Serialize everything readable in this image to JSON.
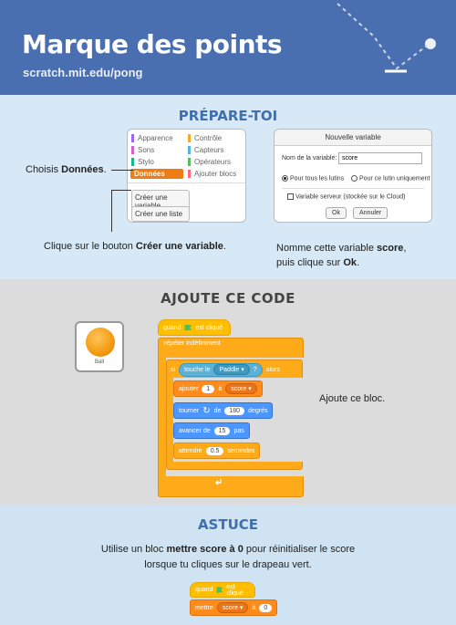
{
  "header": {
    "title": "Marque des points",
    "url": "scratch.mit.edu/pong"
  },
  "prepare": {
    "title": "PRÉPARE-TOI",
    "categories": [
      {
        "label": "Apparence",
        "color": "#9966ff"
      },
      {
        "label": "Contrôle",
        "color": "#ffab19"
      },
      {
        "label": "Sons",
        "color": "#cf63cf"
      },
      {
        "label": "Capteurs",
        "color": "#5cb1d6"
      },
      {
        "label": "Stylo",
        "color": "#0fbd8c"
      },
      {
        "label": "Opérateurs",
        "color": "#59c059"
      },
      {
        "label": "Données",
        "color": "#ff8c1a"
      },
      {
        "label": "Ajouter blocs",
        "color": "#ff6680"
      }
    ],
    "make_var_button": "Créer une variable",
    "make_list_button": "Créer une liste",
    "choose_text_prefix": "Choisis ",
    "choose_text_bold": "Données",
    "choose_text_suffix": ".",
    "click_text_prefix": "Clique sur le bouton ",
    "click_text_bold": "Créer une variable",
    "click_text_suffix": ".",
    "name_text_1": "Nomme cette variable ",
    "name_text_bold1": "score",
    "name_text_2": ",",
    "name_text_3": "puis clique sur ",
    "name_text_bold2": "Ok",
    "name_text_4": ".",
    "dialog": {
      "title": "Nouvelle variable",
      "name_label": "Nom de la variable:",
      "name_value": "score",
      "radio_all": "Pour tous les lutins",
      "radio_this": "Pour ce lutin uniquement",
      "cloud_label": "Variable serveur (stockée sur le Cloud)",
      "ok": "Ok",
      "cancel": "Annuler"
    }
  },
  "code": {
    "title": "AJOUTE CE CODE",
    "sprite_name": "Ball",
    "when_flag": "quand",
    "clicked": "est cliqué",
    "forever": "répéter indéfiniment",
    "if": "si",
    "touching": "touche le",
    "paddle": "Paddle",
    "q": "?",
    "then": "alors",
    "add": "ajouter",
    "add_value": "1",
    "to": "à",
    "score_var": "score",
    "turn": "tourner",
    "of": "de",
    "turn_value": "180",
    "degrees": "degrés",
    "move": "avancer de",
    "move_value": "15",
    "steps": "pas",
    "wait": "attendre",
    "wait_value": "0.5",
    "seconds": "secondes",
    "note": "Ajoute ce bloc."
  },
  "tip": {
    "title": "ASTUCE",
    "line1_a": "Utilise un bloc ",
    "line1_bold": "mettre score à 0",
    "line1_b": " pour réinitialiser le score",
    "line2": "lorsque tu cliques sur le drapeau vert.",
    "when_flag": "quand",
    "clicked": "est cliqué",
    "set": "mettre",
    "score_var": "score",
    "to": "à",
    "set_value": "0"
  }
}
